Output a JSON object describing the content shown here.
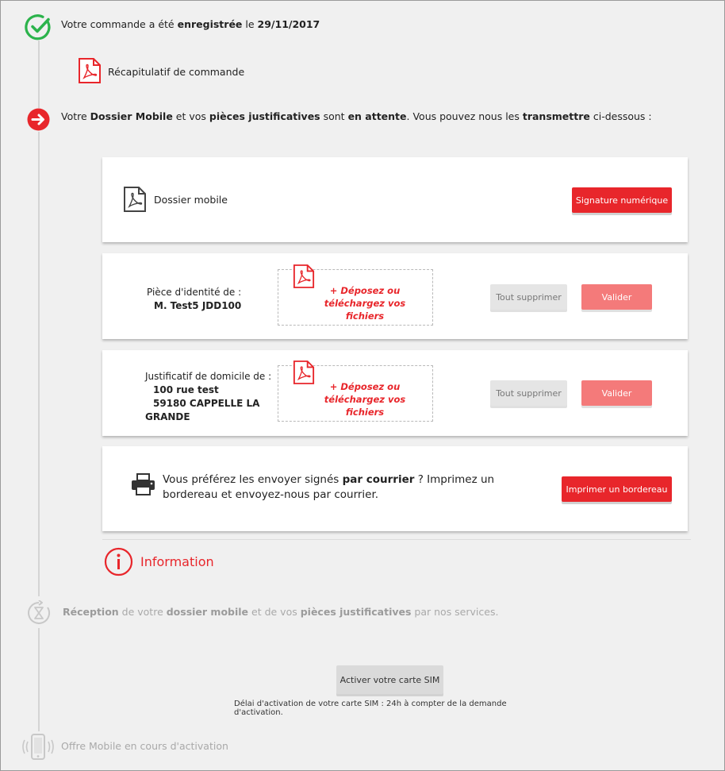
{
  "steps": {
    "order": {
      "text_pre": "Votre commande a été ",
      "text_bold": "enregistrée",
      "text_mid": " le ",
      "date": "29/11/2017",
      "recap_label": "Récapitulatif de commande"
    },
    "pending": {
      "t1": "Votre ",
      "b1": "Dossier Mobile",
      "t2": " et vos ",
      "b2": "pièces justificatives",
      "t3": " sont ",
      "b3": "en attente",
      "t4": ". Vous pouvez nous les ",
      "b4": "transmettre",
      "t5": " ci-dessous :"
    },
    "reception": {
      "b1": "Réception",
      "t1": " de votre ",
      "b2": "dossier mobile",
      "t2": " et de vos ",
      "b3": "pièces justificatives",
      "t3": " par nos services."
    },
    "activation": {
      "button": "Activer votre carte SIM",
      "delay": "Délai d'activation de votre carte SIM : 24h à compter de la demande d'activation."
    },
    "offer": {
      "text": "Offre Mobile en cours d'activation"
    }
  },
  "cards": {
    "dossier": {
      "label": "Dossier mobile",
      "button": "Signature numérique"
    },
    "identity": {
      "label": "Pièce d'identité de :",
      "name": "M. Test5 JDD100",
      "drop_plus": "+",
      "drop_line1": "Déposez ou",
      "drop_line2": "téléchargez vos fichiers",
      "delete_button": "Tout supprimer",
      "validate_button": "Valider"
    },
    "domicile": {
      "label": "Justificatif de domicile de :",
      "address1": "100 rue test",
      "address2": "59180 CAPPELLE LA",
      "address3": "GRANDE",
      "drop_plus": "+",
      "drop_line1": "Déposez ou",
      "drop_line2": "téléchargez vos fichiers",
      "delete_button": "Tout supprimer",
      "validate_button": "Valider"
    },
    "mail": {
      "t1": "Vous préférez les envoyer signés ",
      "b1": "par courrier",
      "t2": " ? Imprimez un bordereau et envoyez-nous par courrier.",
      "button": "Imprimer un bordereau"
    }
  },
  "information": {
    "label": "Information"
  },
  "colors": {
    "accent": "#e8262b",
    "success": "#2bb34b",
    "muted": "#a9a9a9"
  },
  "icons": {
    "done": "check-circle-icon",
    "current": "arrow-right-circle-icon",
    "pdf": "pdf-file-icon",
    "printer": "printer-icon",
    "info": "info-circle-icon",
    "reception": "clock-refresh-icon",
    "phone": "mobile-phone-icon"
  }
}
